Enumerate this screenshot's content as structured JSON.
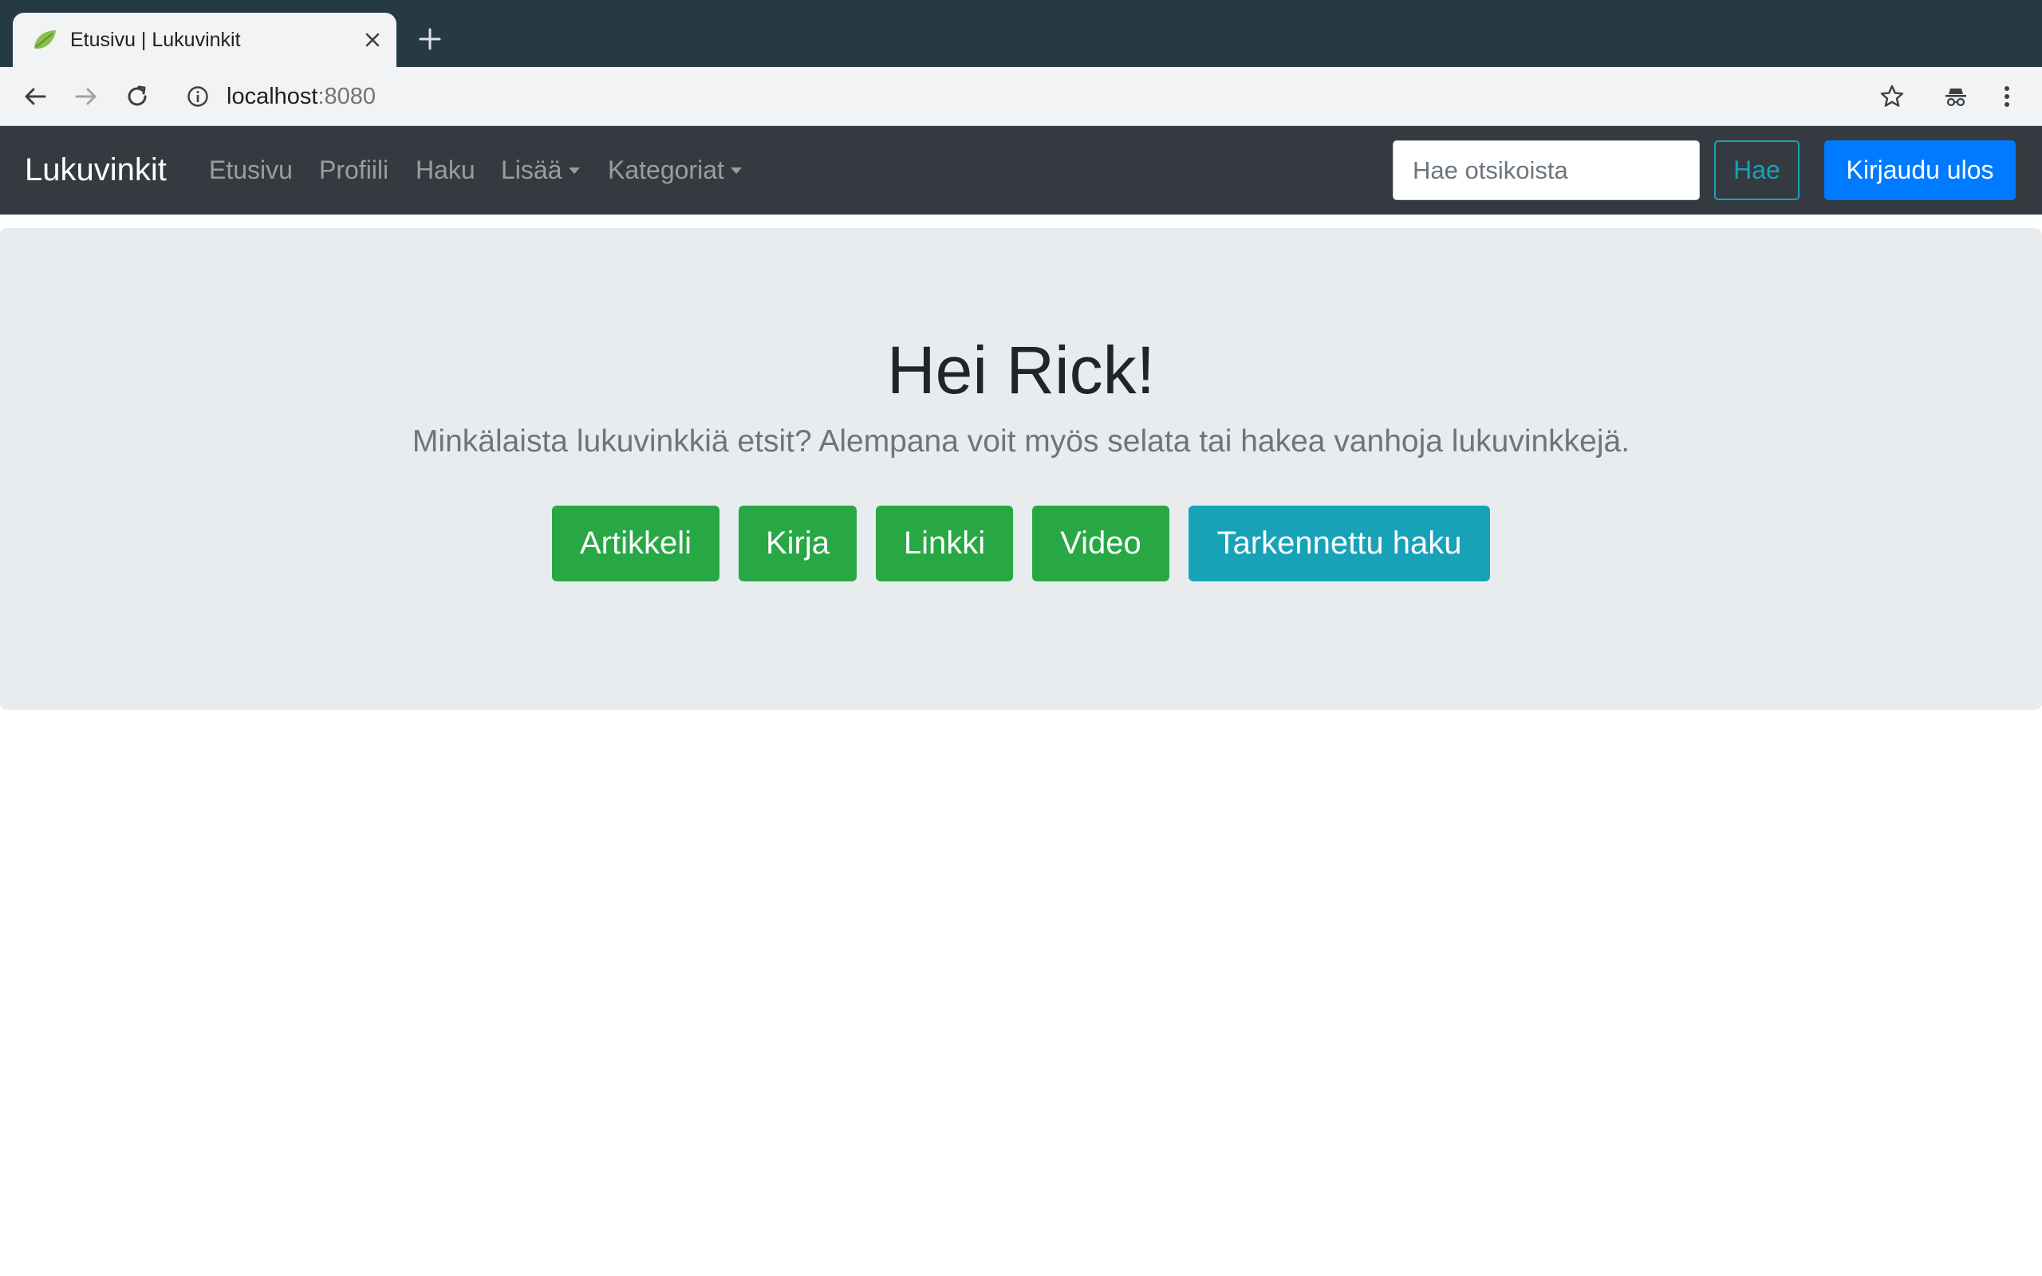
{
  "browser": {
    "tab": {
      "title": "Etusivu | Lukuvinkit",
      "favicon": "leaf-icon"
    },
    "url": {
      "host": "localhost",
      "port": ":8080"
    },
    "colors": {
      "tabstrip": "#263a44",
      "toolbar": "#f2f3f5"
    }
  },
  "navbar": {
    "brand": "Lukuvinkit",
    "links": [
      {
        "label": "Etusivu"
      },
      {
        "label": "Profiili"
      },
      {
        "label": "Haku"
      },
      {
        "label": "Lisää",
        "dropdown": true
      },
      {
        "label": "Kategoriat",
        "dropdown": true
      }
    ],
    "search": {
      "placeholder": "Hae otsikoista",
      "value": ""
    },
    "search_button": "Hae",
    "logout_button": "Kirjaudu ulos",
    "colors": {
      "background": "#343a40",
      "search_button": "#17a2b8",
      "logout_button": "#007bff"
    }
  },
  "hero": {
    "title": "Hei Rick!",
    "lead": "Minkälaista lukuvinkkiä etsit? Alempana voit myös selata tai hakea vanhoja lukuvinkkejä.",
    "buttons": [
      {
        "label": "Artikkeli",
        "color": "#28a745"
      },
      {
        "label": "Kirja",
        "color": "#28a745"
      },
      {
        "label": "Linkki",
        "color": "#28a745"
      },
      {
        "label": "Video",
        "color": "#28a745"
      },
      {
        "label": "Tarkennettu haku",
        "color": "#17a2b8"
      }
    ],
    "background": "#e9ecef"
  }
}
